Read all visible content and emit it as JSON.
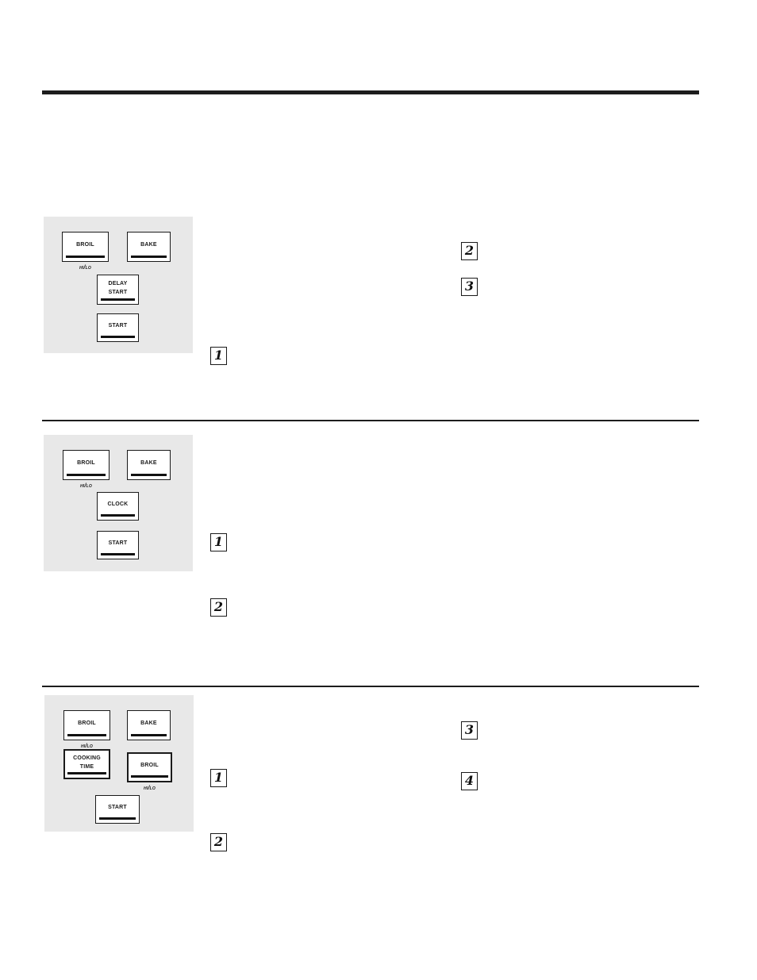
{
  "page": {
    "background_color": "#ffffff",
    "rule_color": "#1d1d1d",
    "panel_color": "#e8e8e8",
    "heading": "",
    "intro": ""
  },
  "sections": [
    {
      "id": "delay-start",
      "title": "",
      "body": "",
      "panel": {
        "name": "control-panel-delay-start",
        "keys": [
          {
            "name": "broil-key",
            "label": "Broil",
            "sublabel": "Hi/Lo",
            "emphasis": false
          },
          {
            "name": "bake-key",
            "label": "Bake",
            "sublabel": "",
            "emphasis": false
          },
          {
            "name": "delay-start-key",
            "label": "Delay Start",
            "sublabel": "",
            "emphasis": false
          },
          {
            "name": "start-key",
            "label": "Start",
            "sublabel": "",
            "emphasis": false
          }
        ]
      },
      "steps": [
        {
          "number": "1",
          "text": ""
        },
        {
          "number": "2",
          "text": ""
        },
        {
          "number": "3",
          "text": ""
        }
      ]
    },
    {
      "id": "set-clock",
      "title": "",
      "body": "",
      "panel": {
        "name": "control-panel-clock",
        "keys": [
          {
            "name": "broil-key",
            "label": "Broil",
            "sublabel": "Hi/Lo",
            "emphasis": false
          },
          {
            "name": "bake-key",
            "label": "Bake",
            "sublabel": "",
            "emphasis": false
          },
          {
            "name": "clock-key",
            "label": "Clock",
            "sublabel": "",
            "emphasis": false
          },
          {
            "name": "start-key",
            "label": "Start",
            "sublabel": "",
            "emphasis": false
          }
        ]
      },
      "steps": [
        {
          "number": "1",
          "text": ""
        },
        {
          "number": "2",
          "text": ""
        }
      ]
    },
    {
      "id": "cooking-time",
      "title": "",
      "body": "",
      "panel": {
        "name": "control-panel-cooking-time",
        "keys": [
          {
            "name": "broil-key",
            "label": "Broil",
            "sublabel": "Hi/Lo",
            "emphasis": false
          },
          {
            "name": "bake-key",
            "label": "Bake",
            "sublabel": "",
            "emphasis": false
          },
          {
            "name": "cooking-time-key",
            "label": "Cooking Time",
            "sublabel": "",
            "emphasis": true
          },
          {
            "name": "broil-hilo-key",
            "label": "Broil",
            "sublabel": "Hi/Lo",
            "emphasis": true
          },
          {
            "name": "start-key",
            "label": "Start",
            "sublabel": "",
            "emphasis": false
          }
        ]
      },
      "steps": [
        {
          "number": "1",
          "text": ""
        },
        {
          "number": "2",
          "text": ""
        },
        {
          "number": "3",
          "text": ""
        },
        {
          "number": "4",
          "text": ""
        }
      ]
    }
  ]
}
